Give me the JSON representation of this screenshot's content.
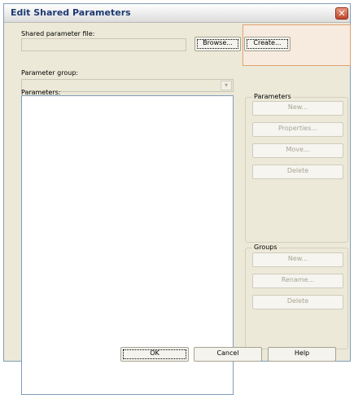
{
  "window": {
    "title": "Edit Shared Parameters",
    "close": "✕"
  },
  "shared_file": {
    "label": "Shared parameter file:",
    "value": "",
    "browse_label": "Browse...",
    "create_label": "Create..."
  },
  "parameter_group": {
    "label": "Parameter group:",
    "value": ""
  },
  "parameters_list": {
    "label": "Parameters:"
  },
  "parameters_group": {
    "title": "Parameters",
    "buttons": [
      "New...",
      "Properties...",
      "Move...",
      "Delete"
    ]
  },
  "groups_group": {
    "title": "Groups",
    "buttons": [
      "New...",
      "Rename...",
      "Delete"
    ]
  },
  "footer": {
    "ok": "OK",
    "cancel": "Cancel",
    "help": "Help"
  }
}
